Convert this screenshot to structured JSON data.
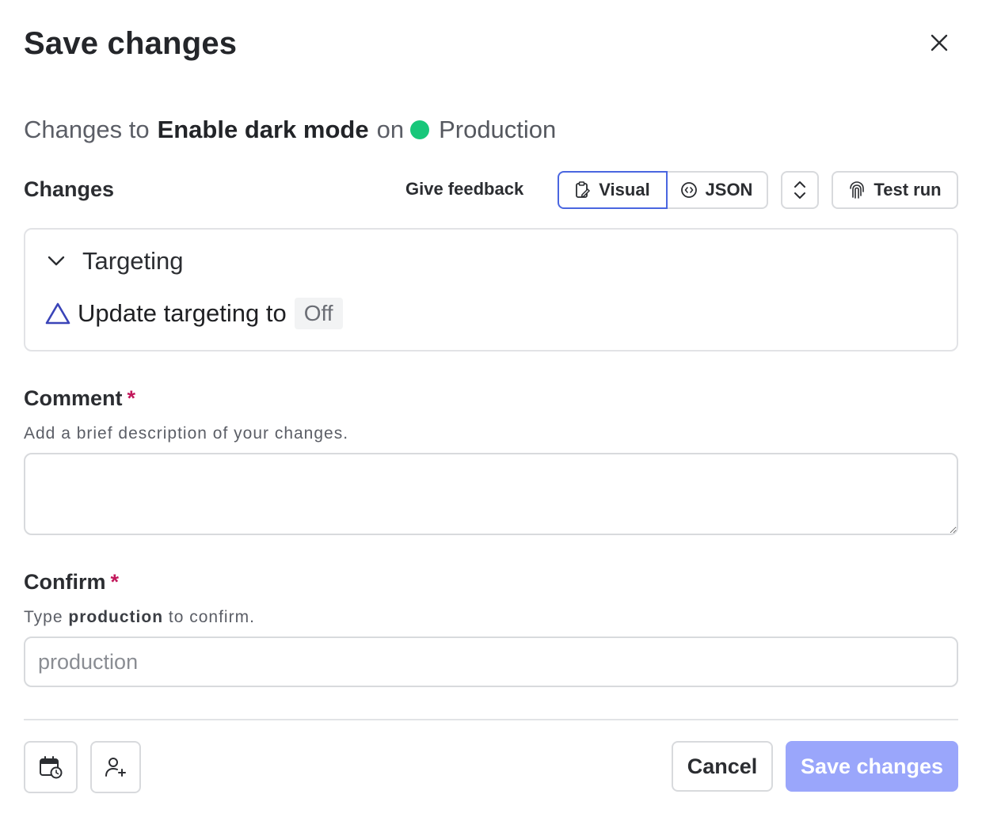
{
  "dialog": {
    "title": "Save changes",
    "close_icon": "close-icon"
  },
  "summary": {
    "prefix": "Changes to",
    "flag_name": "Enable dark mode",
    "connector": "on",
    "environment": "Production",
    "environment_color": "#18c77a"
  },
  "changes": {
    "label": "Changes",
    "feedback_label": "Give feedback",
    "view_visual_label": "Visual",
    "view_json_label": "JSON",
    "test_run_label": "Test run",
    "active_view": "Visual",
    "accent_color": "#4a66e0"
  },
  "targeting": {
    "section_title": "Targeting",
    "change_text": "Update targeting to",
    "new_value": "Off"
  },
  "comment": {
    "label": "Comment",
    "required_mark": "*",
    "help": "Add a brief description of your changes.",
    "value": "",
    "placeholder": ""
  },
  "confirm": {
    "label": "Confirm",
    "required_mark": "*",
    "help_prefix": "Type",
    "help_keyword": "production",
    "help_suffix": "to confirm.",
    "value": "",
    "placeholder": "production"
  },
  "footer": {
    "schedule_icon": "calendar-clock-icon",
    "reviewer_icon": "add-user-icon",
    "cancel_label": "Cancel",
    "save_label": "Save changes",
    "save_color": "#9aa6fb"
  }
}
